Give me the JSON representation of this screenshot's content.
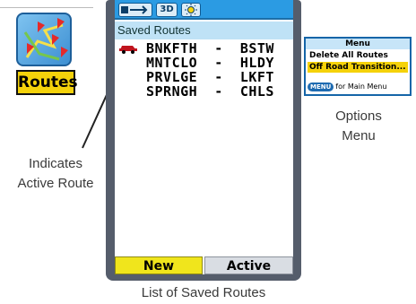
{
  "routes_icon": {
    "label": "Routes"
  },
  "callouts": {
    "active_route_line1": "Indicates",
    "active_route_line2": "Active Route",
    "options_menu_line1": "Options",
    "options_menu_line2": "Menu",
    "saved_list": "List of Saved Routes"
  },
  "device": {
    "status_icons": [
      "satellite-icon",
      "3d-icon",
      "backlight-icon"
    ],
    "status_3d_label": "3D",
    "screen_title": "Saved Routes",
    "routes": [
      {
        "name": "BNKFTH  -  BSTW",
        "active": true
      },
      {
        "name": "MNTCLO  -  HLDY",
        "active": false
      },
      {
        "name": "PRVLGE  -  LKFT",
        "active": false
      },
      {
        "name": "SPRNGH  -  CHLS",
        "active": false
      }
    ],
    "softkeys": {
      "new": "New",
      "active": "Active"
    }
  },
  "options_menu": {
    "title": "Menu",
    "items": [
      "Delete All Routes",
      "Off Road Transition..."
    ],
    "footer_key": "MENU",
    "footer_text": "for Main Menu"
  },
  "colors": {
    "status_bar": "#2b9be3",
    "title_bar": "#bfe2f6",
    "softkey_highlight": "#f0e51c",
    "menu_highlight": "#f5d20a",
    "active_route_marker": "#c0141e"
  }
}
